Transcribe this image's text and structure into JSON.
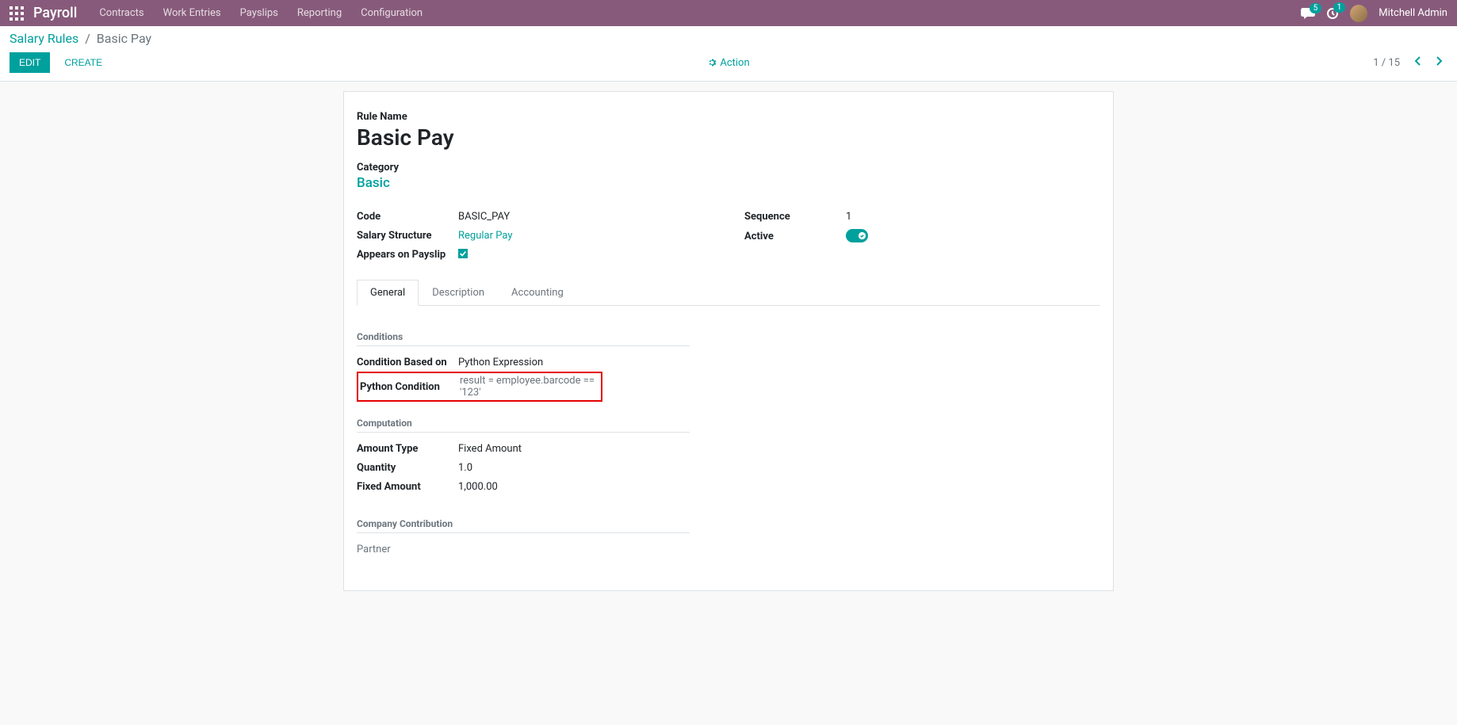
{
  "nav": {
    "app_title": "Payroll",
    "links": [
      "Contracts",
      "Work Entries",
      "Payslips",
      "Reporting",
      "Configuration"
    ],
    "chat_badge": "5",
    "activity_badge": "1",
    "user_name": "Mitchell Admin"
  },
  "breadcrumb": {
    "parent": "Salary Rules",
    "current": "Basic Pay"
  },
  "controls": {
    "edit": "EDIT",
    "create": "CREATE",
    "action": "Action",
    "pager": "1 / 15"
  },
  "form": {
    "rule_name_label": "Rule Name",
    "rule_name": "Basic Pay",
    "category_label": "Category",
    "category": "Basic",
    "left": {
      "code_label": "Code",
      "code": "BASIC_PAY",
      "salary_structure_label": "Salary Structure",
      "salary_structure": "Regular Pay",
      "appears_label": "Appears on Payslip"
    },
    "right": {
      "sequence_label": "Sequence",
      "sequence": "1",
      "active_label": "Active"
    }
  },
  "tabs": {
    "general": "General",
    "description": "Description",
    "accounting": "Accounting"
  },
  "general_tab": {
    "conditions_title": "Conditions",
    "condition_based_label": "Condition Based on",
    "condition_based_val": "Python Expression",
    "python_condition_label": "Python Condition",
    "python_condition_val": "result = employee.barcode == '123'",
    "computation_title": "Computation",
    "amount_type_label": "Amount Type",
    "amount_type_val": "Fixed Amount",
    "quantity_label": "Quantity",
    "quantity_val": "1.0",
    "fixed_amount_label": "Fixed Amount",
    "fixed_amount_val": "1,000.00",
    "company_contrib_title": "Company Contribution",
    "partner_label": "Partner"
  }
}
